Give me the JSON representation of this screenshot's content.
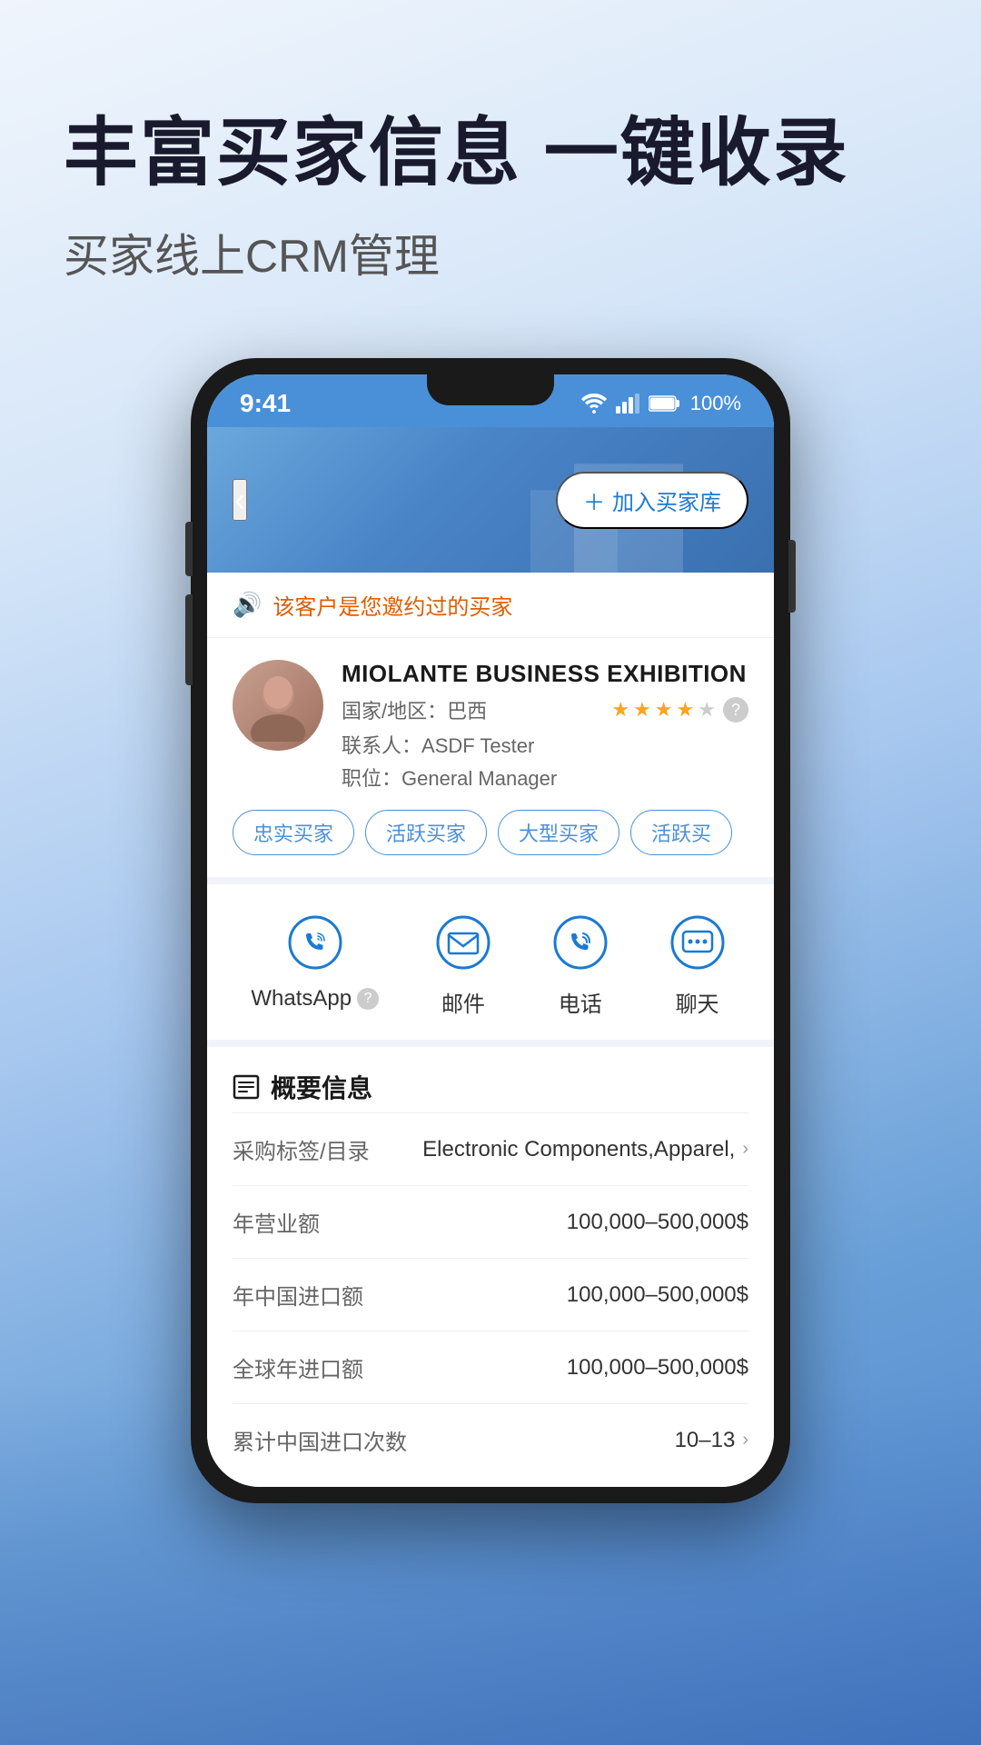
{
  "hero": {
    "title": "丰富买家信息 一键收录",
    "subtitle": "买家线上CRM管理"
  },
  "phone": {
    "status_bar": {
      "time": "9:41",
      "battery": "100%"
    },
    "header": {
      "back_label": "‹",
      "add_button": "+ 加入买家库"
    },
    "alert": {
      "text": "该客户是您邀约过的买家"
    },
    "company": {
      "name": "MIOLANTE BUSINESS EXHIBITION",
      "country_label": "国家/地区：",
      "country": "巴西",
      "stars": 4,
      "max_stars": 5,
      "contact_label": "联系人：",
      "contact": "ASDF Tester",
      "position_label": "职位：",
      "position": "General Manager",
      "tags": [
        "忠实买家",
        "活跃买家",
        "大型买家",
        "活跃买"
      ]
    },
    "actions": [
      {
        "id": "whatsapp",
        "label": "WhatsApp",
        "has_help": true
      },
      {
        "id": "email",
        "label": "邮件",
        "has_help": false
      },
      {
        "id": "phone",
        "label": "电话",
        "has_help": false
      },
      {
        "id": "chat",
        "label": "聊天",
        "has_help": false
      }
    ],
    "info_section": {
      "title": "概要信息",
      "rows": [
        {
          "label": "采购标签/目录",
          "value": "Electronic Components,Apparel,",
          "has_chevron": true
        },
        {
          "label": "年营业额",
          "value": "100,000–500,000$",
          "has_chevron": false
        },
        {
          "label": "年中国进口额",
          "value": "100,000–500,000$",
          "has_chevron": false
        },
        {
          "label": "全球年进口额",
          "value": "100,000–500,000$",
          "has_chevron": false
        },
        {
          "label": "累计中国进口次数",
          "value": "10–13",
          "has_chevron": true
        }
      ]
    }
  }
}
